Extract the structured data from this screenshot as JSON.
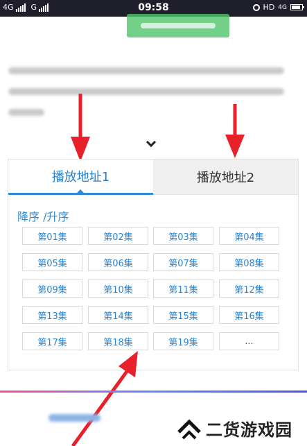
{
  "status_bar": {
    "left_network_1": "4G",
    "left_network_2": "G",
    "time": "09:58",
    "right_label": "HD",
    "right_network": "4G"
  },
  "episode_panel": {
    "tabs": [
      "播放地址1",
      "播放地址2"
    ],
    "active_tab": "播放地址1",
    "sort_label": "降序 /升序",
    "episodes": [
      "第01集",
      "第02集",
      "第03集",
      "第04集",
      "第05集",
      "第06集",
      "第07集",
      "第08集",
      "第09集",
      "第10集",
      "第11集",
      "第12集",
      "第13集",
      "第14集",
      "第15集",
      "第16集",
      "第17集",
      "第18集",
      "第19集",
      "..."
    ]
  },
  "brand": {
    "name": "二货游戏园"
  },
  "colors": {
    "accent_blue": "#2f8ad8",
    "red_arrow": "#e8202a",
    "green_button": "#4fc56b"
  },
  "icons": {
    "expand": "chevron-down-icon",
    "brand_logo": "double-chevron-up-icon"
  }
}
